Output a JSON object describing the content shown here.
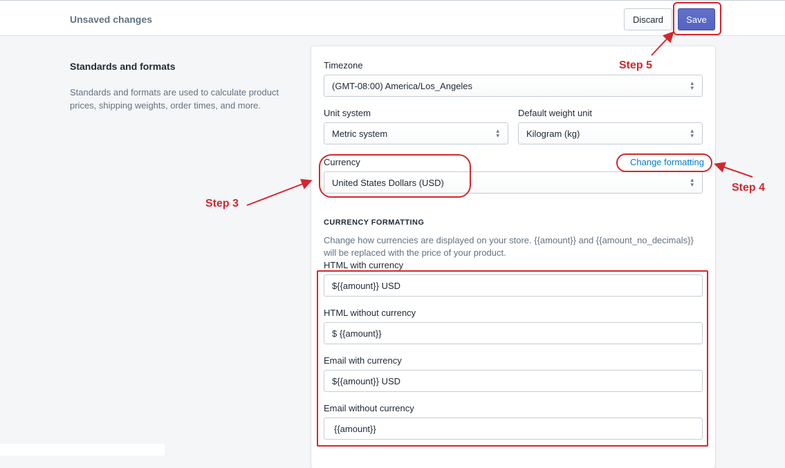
{
  "topbar": {
    "title": "Unsaved changes",
    "discard_label": "Discard",
    "save_label": "Save"
  },
  "section": {
    "title": "Standards and formats",
    "description": "Standards and formats are used to calculate product prices, shipping weights, order times, and more."
  },
  "form": {
    "timezone": {
      "label": "Timezone",
      "value": "(GMT-08:00) America/Los_Angeles"
    },
    "unit_system": {
      "label": "Unit system",
      "value": "Metric system"
    },
    "weight_unit": {
      "label": "Default weight unit",
      "value": "Kilogram (kg)"
    },
    "currency": {
      "label": "Currency",
      "value": "United States Dollars (USD)",
      "change_link": "Change formatting"
    },
    "currency_formatting": {
      "heading": "CURRENCY FORMATTING",
      "help": "Change how currencies are displayed on your store. {{amount}} and {{amount_no_decimals}} will be replaced with the price of your product.",
      "html_with_currency": {
        "label": "HTML with currency",
        "value": "${{amount}} USD"
      },
      "html_without_currency": {
        "label": "HTML without currency",
        "value": "$ {{amount}}"
      },
      "email_with_currency": {
        "label": "Email with currency",
        "value": "${{amount}} USD"
      },
      "email_without_currency": {
        "label": "Email without currency",
        "value": "{{amount}}"
      }
    }
  },
  "annotations": {
    "step3": "Step 3",
    "step4": "Step 4",
    "step5": "Step 5",
    "color": "#d3262e"
  },
  "icons": {
    "select_chevron": "select-chevron-icon",
    "arrow": "arrow-icon"
  }
}
